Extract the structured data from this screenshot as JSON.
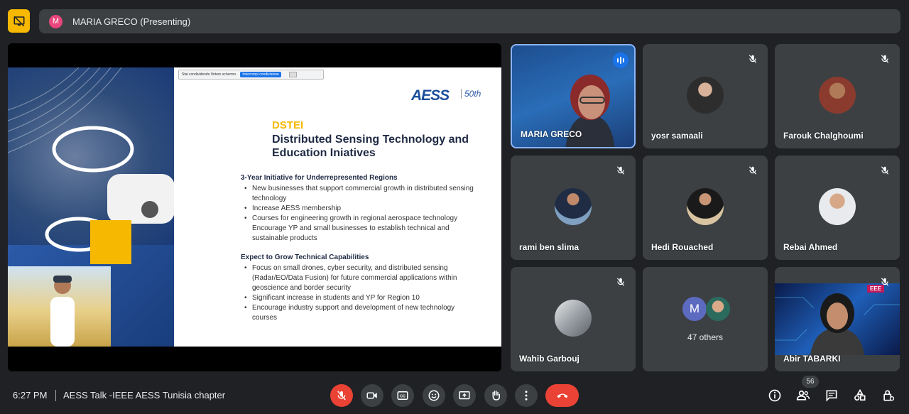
{
  "presenter": {
    "avatar_letter": "M",
    "label": "MARIA GRECO (Presenting)"
  },
  "slide": {
    "share_notice": "Stai condividendo l'intero schermo.",
    "share_stop": "Interrompi condivisione",
    "logo": "AESS",
    "anniversary": "50th",
    "kicker": "DSTEI",
    "title": "Distributed Sensing Technology and Education Iniatives",
    "section1_heading": "3-Year Initiative for Underrepresented Regions",
    "section1_items": [
      "New businesses that support commercial growth in distributed sensing technology",
      "Increase AESS membership",
      "Courses for engineering growth in regional aerospace technology Encourage YP and small businesses to establish technical and sustainable products"
    ],
    "section2_heading": "Expect to Grow Technical Capabilities",
    "section2_items": [
      "Focus on small drones, cyber security, and distributed sensing (Radar/EO/Data Fusion) for future commercial applications within geoscience and border security",
      "Significant increase in students and YP for Region 10",
      "Encourage industry support and development of new technology courses"
    ]
  },
  "participants": [
    {
      "name": "MARIA GRECO",
      "speaking": true
    },
    {
      "name": "yosr samaali",
      "muted": true
    },
    {
      "name": "Farouk Chalghoumi",
      "muted": true
    },
    {
      "name": "rami ben slima",
      "muted": true
    },
    {
      "name": "Hedi Rouached",
      "muted": true
    },
    {
      "name": "Rebai Ahmed",
      "muted": true
    },
    {
      "name": "Wahib Garbouj",
      "muted": true
    },
    {
      "others_letter": "M",
      "others_label": "47 others"
    },
    {
      "name": "Abir TABARKI",
      "muted": true,
      "video_badge": "EEE"
    }
  ],
  "bottom": {
    "time": "6:27 PM",
    "meeting_title": "AESS Talk -IEEE AESS Tunisia chapter",
    "people_count": "56"
  },
  "colors": {
    "background": "#202124",
    "tile": "#3c4043",
    "accent_red": "#ea4335",
    "accent_blue": "#8ab4f8",
    "present_yellow": "#f6b800"
  },
  "icons": [
    "presentation-icon",
    "mic-off-icon",
    "camera-icon",
    "captions-icon",
    "emoji-icon",
    "present-screen-icon",
    "raise-hand-icon",
    "more-options-icon",
    "hang-up-icon",
    "info-icon",
    "people-icon",
    "chat-icon",
    "activities-icon",
    "host-controls-icon"
  ]
}
